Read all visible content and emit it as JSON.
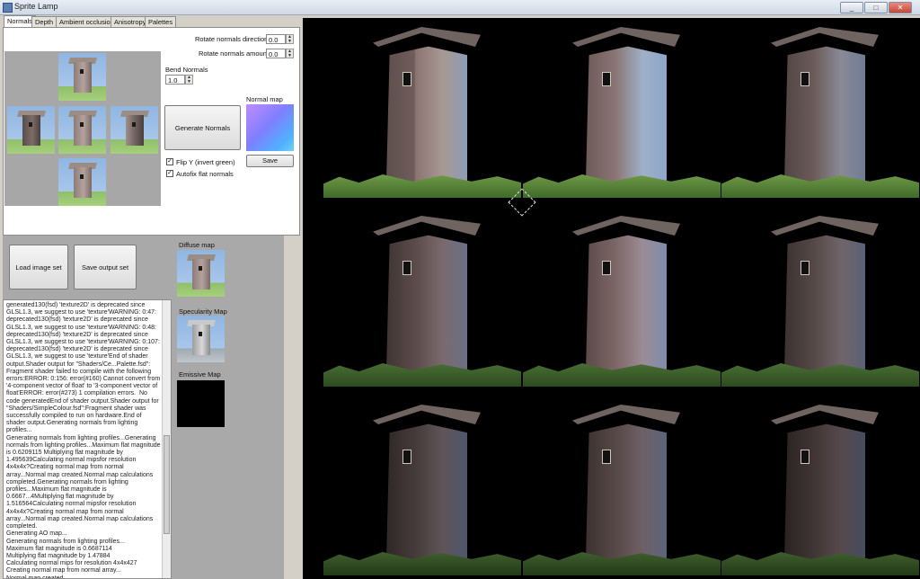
{
  "window": {
    "title": "Sprite Lamp"
  },
  "tabs": [
    {
      "label": "Normals"
    },
    {
      "label": "Depth"
    },
    {
      "label": "Ambient occlusion"
    },
    {
      "label": "Anisotropy"
    },
    {
      "label": "Palettes"
    }
  ],
  "normals": {
    "rotate_direction_label": "Rotate normals direction",
    "rotate_direction_value": "0.0",
    "rotate_amount_label": "Rotate normals amount",
    "rotate_amount_value": "0.0",
    "bend_label": "Bend Normals",
    "bend_value": "1.0",
    "generate_label": "Generate Normals",
    "normal_map_label": "Normal map",
    "save_label": "Save",
    "flip_y_label": "Flip Y (invert green)",
    "autofix_label": "Autofix flat normals",
    "flip_y_checked": true,
    "autofix_checked": true
  },
  "actions": {
    "load_images_label": "Load image set",
    "save_output_label": "Save output set"
  },
  "maps": {
    "diffuse_label": "Diffuse map",
    "specularity_label": "Specularity Map",
    "emissive_label": "Emissive Map"
  },
  "log": {
    "text": "generated130(fsd) 'texture2D' is deprecated since GLSL1.3, we suggest to use 'texture'WARNING: 0:47: deprecated130(fsd) 'texture2D' is deprecated since GLSL1.3, we suggest to use 'texture'WARNING: 0:48: deprecated130(fsd) 'texture2D' is deprecated since GLSL1.3, we suggest to use 'texture'WARNING: 0:107: deprecated130(fsd) 'texture2D' is deprecated since GLSL1.3, we suggest to use 'texture'End of shader output.Shader output for \"Shaders/Ce...Palette.fsd\": Fragment shader failed to compile with the following errors:ERROR: 0:156: error(#160) Cannot convert from '4-component vector of float' to '3-component vector of float'ERROR: error(#273) 1 compilation errors.  No code generatedEnd of shader output.Shader output for \"Shaders/SimpleColour.fsd\":Fragment shader was successfully compiled to run on hardware.End of shader output.Generating normals from lighting profiles...\nGenerating normals from lighting profiles...Generating normals from lighting profiles...Maximum flat magnitude is 0.6209115 Multiplying flat magnitude by 1.495639Calculating normal mipsfor resolution 4x4x4x?Creating normal map from normal array...Normal map created.Normal map calculations completed.Generating normals from lighting profiles...Maximum flat magnitude is 0.6667...4Multiplying flat magnitude by 1.516564Calculating normal mipsfor resolution 4x4x4x?Creating normal map from normal array...Normal map created.Normal map calculations completed.\nGenerating AO map...\nGenerating normals from lighting profiles...\nMaximum flat magnitude is 0.6687114\nMultiplying flat magnitude by 1.47884\nCalculating normal mips for resolution 4x4x427\nCreating normal map from normal array...\nNormal map created.\nNormal map calculations completed."
  },
  "colors": {
    "chrome": "#d4d0c8",
    "panel_gray": "#a9a9a9",
    "render_bg": "#000000",
    "normal_map_blue": "#7f7fff"
  },
  "icons": {
    "app": "sprite-lamp-icon",
    "minimize": "minimize-icon",
    "maximize": "maximize-icon",
    "close": "close-icon"
  }
}
